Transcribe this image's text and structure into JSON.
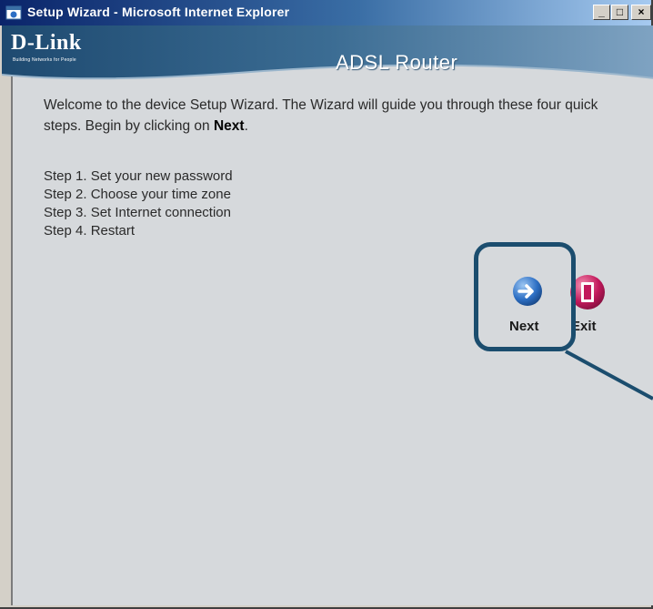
{
  "window": {
    "title": "Setup Wizard - Microsoft Internet Explorer",
    "controls": {
      "minimize": "_",
      "maximize": "□",
      "close": "×"
    }
  },
  "header": {
    "brand": "D-Link",
    "tagline": "Building Networks for People",
    "product": "ADSL Router"
  },
  "intro": {
    "text_before": "Welcome to the device Setup Wizard. The Wizard will guide you through these four quick steps. Begin by clicking on ",
    "emphasis": "Next",
    "text_after": "."
  },
  "steps": [
    "Step 1. Set your new password",
    "Step 2. Choose your time zone",
    "Step 3. Set Internet connection",
    "Step 4. Restart"
  ],
  "buttons": {
    "next_label": "Next",
    "exit_label": "Exit"
  },
  "icons": {
    "next": "arrow-right-circle-icon",
    "exit": "exit-door-icon"
  },
  "colors": {
    "titlebar": "#0a246a",
    "banner": "#2f5f86",
    "page_bg": "#d6d9dc",
    "next_icon": "#2d6fc4",
    "exit_icon": "#c2185b",
    "callout": "#1b4d6e"
  }
}
